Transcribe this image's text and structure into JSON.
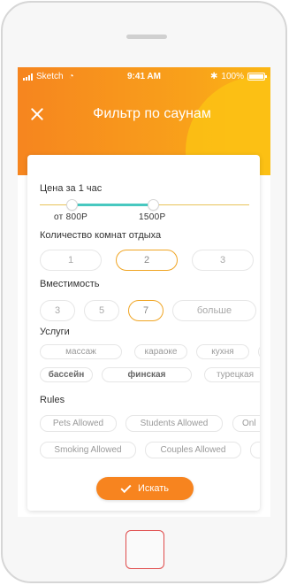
{
  "status_bar": {
    "carrier": "Sketch",
    "time": "9:41 AM",
    "battery": "100%"
  },
  "header": {
    "title": "Фильтр по саунам",
    "close_icon": "close-icon"
  },
  "price": {
    "label": "Цена за 1 час",
    "min_label": "от 800Р",
    "max_label": "1500Р"
  },
  "rooms": {
    "label": "Количество комнат отдыха",
    "options": [
      "1",
      "2",
      "3"
    ],
    "selected": "2"
  },
  "capacity": {
    "label": "Вместимость",
    "options": [
      "3",
      "5",
      "7",
      "больше"
    ],
    "selected": "7"
  },
  "services": {
    "label": "Услуги",
    "chips": [
      "массаж",
      "караоке",
      "кухня",
      "бассейн",
      "финская",
      "турецкая"
    ]
  },
  "rules": {
    "label": "Rules",
    "chips": [
      "Pets Allowed",
      "Students Allowed",
      "Onl",
      "Smoking Allowed",
      "Couples Allowed"
    ]
  },
  "search_button": {
    "label": "Искать",
    "icon": "checkmark-icon"
  },
  "colors": {
    "accent": "#f7841f",
    "header_gradient_end": "#fbb714",
    "slider_range": "#48c8c0",
    "selected_border": "#f0a524"
  }
}
